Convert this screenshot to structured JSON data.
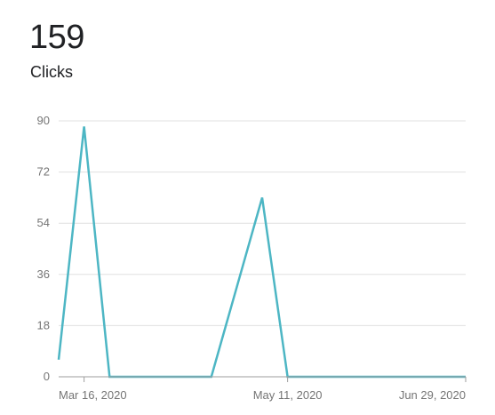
{
  "metric": {
    "value": "159",
    "label": "Clicks"
  },
  "chart_data": {
    "type": "line",
    "title": "",
    "xlabel": "",
    "ylabel": "",
    "x_tick_labels": [
      "Mar 16, 2020",
      "May 11, 2020",
      "Jun 29, 2020"
    ],
    "x_tick_dates": [
      "2020-03-16",
      "2020-05-11",
      "2020-06-29"
    ],
    "ylim": [
      0,
      90
    ],
    "y_ticks": [
      0,
      18,
      36,
      54,
      72,
      90
    ],
    "grid": true,
    "colors": {
      "line": "#4db6c4",
      "grid": "#e0e0e0",
      "axis": "#9e9e9e",
      "ticks": "#757575"
    },
    "series": [
      {
        "points": [
          {
            "x": "2020-03-09",
            "y": 6
          },
          {
            "x": "2020-03-16",
            "y": 88
          },
          {
            "x": "2020-03-23",
            "y": 0
          },
          {
            "x": "2020-04-20",
            "y": 0
          },
          {
            "x": "2020-05-04",
            "y": 63
          },
          {
            "x": "2020-05-11",
            "y": 0
          },
          {
            "x": "2020-06-29",
            "y": 0
          }
        ]
      }
    ]
  }
}
